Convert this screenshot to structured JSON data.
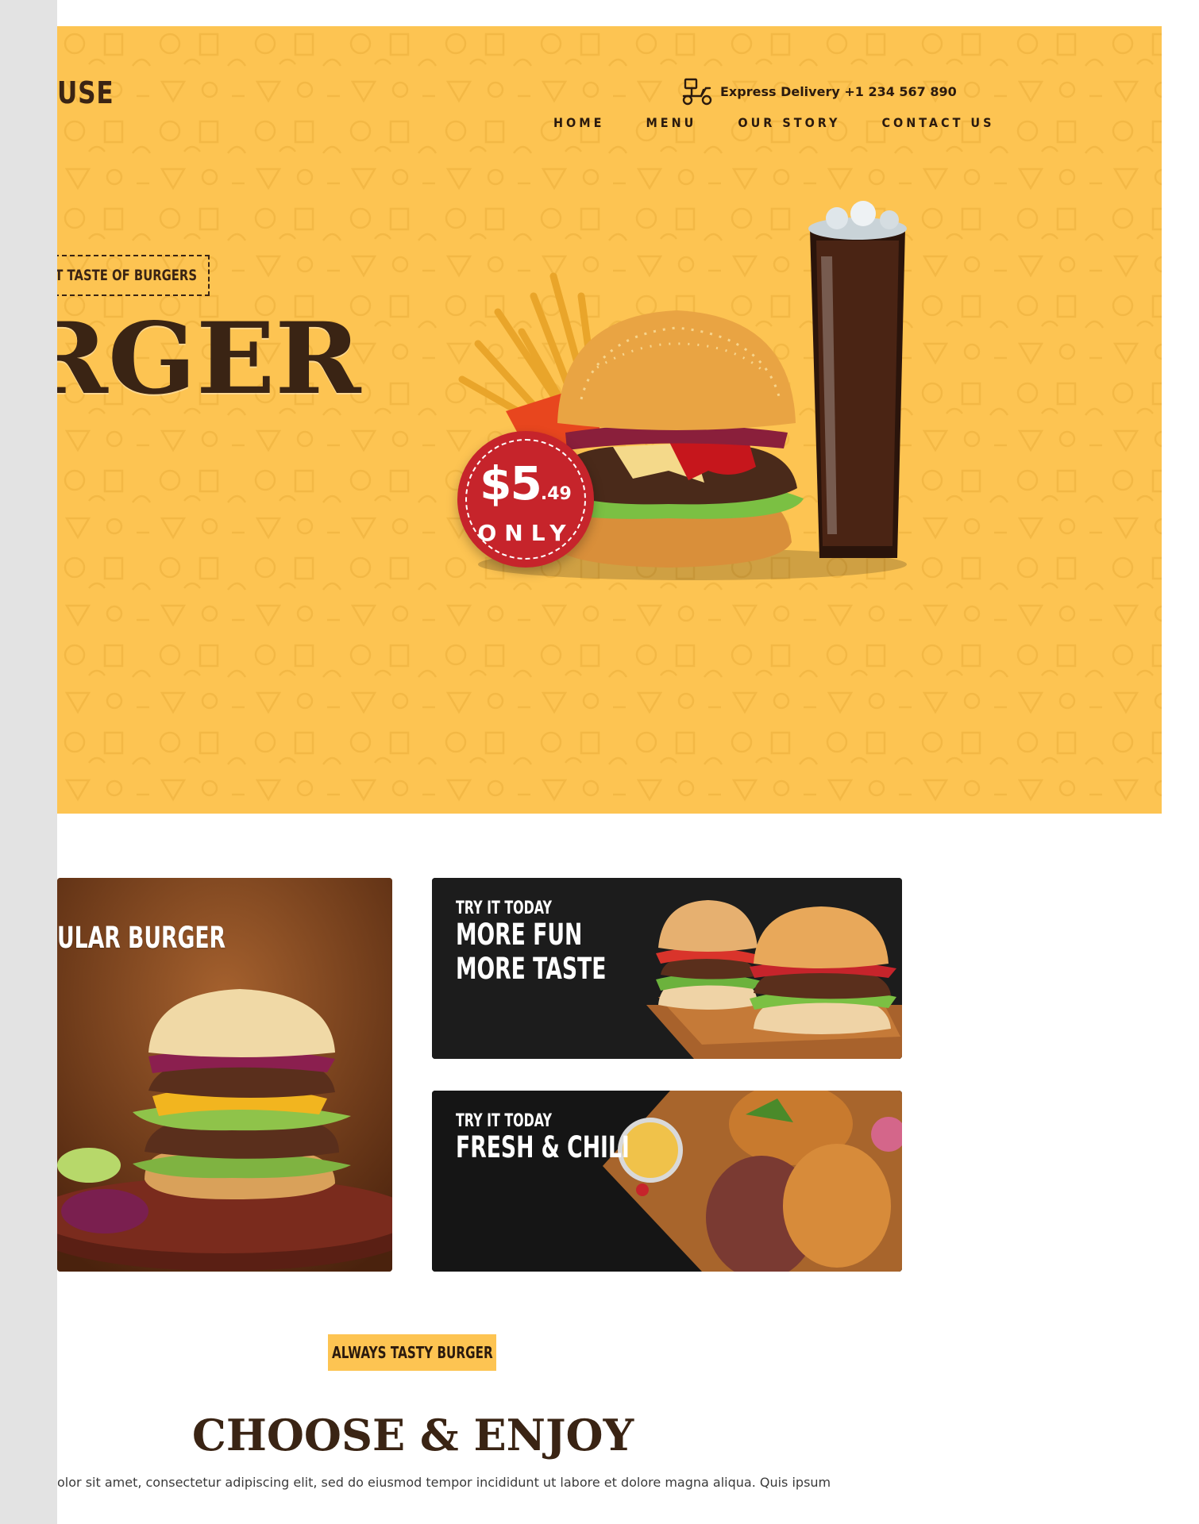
{
  "logo": {
    "text": "USE"
  },
  "header": {
    "delivery_icon": "delivery-scooter-icon",
    "delivery_text": "Express Delivery +1 234 567 890",
    "nav": [
      {
        "label": "HOME"
      },
      {
        "label": "MENU"
      },
      {
        "label": "OUR STORY"
      },
      {
        "label": "CONTACT US"
      }
    ]
  },
  "hero": {
    "tagline": "REAT TASTE OF BURGERS",
    "title": "RGER",
    "price": {
      "dollars": "$5",
      "cents": ".49",
      "label": "ONLY"
    },
    "background_color": "#fdc452",
    "title_color": "#3a2414",
    "badge_color": "#c6242b"
  },
  "promos": {
    "popular": {
      "title": "ULAR BURGER"
    },
    "fun": {
      "kicker": "TRY IT TODAY",
      "line1": "MORE FUN",
      "line2": "MORE TASTE"
    },
    "chili": {
      "kicker": "TRY IT TODAY",
      "title": "FRESH & CHILI"
    }
  },
  "section": {
    "badge": "ALWAYS TASTY BURGER",
    "title": "CHOOSE & ENJOY",
    "text": "olor sit amet, consectetur adipiscing elit, sed do eiusmod tempor incididunt ut labore et dolore magna aliqua. Quis ipsum"
  }
}
